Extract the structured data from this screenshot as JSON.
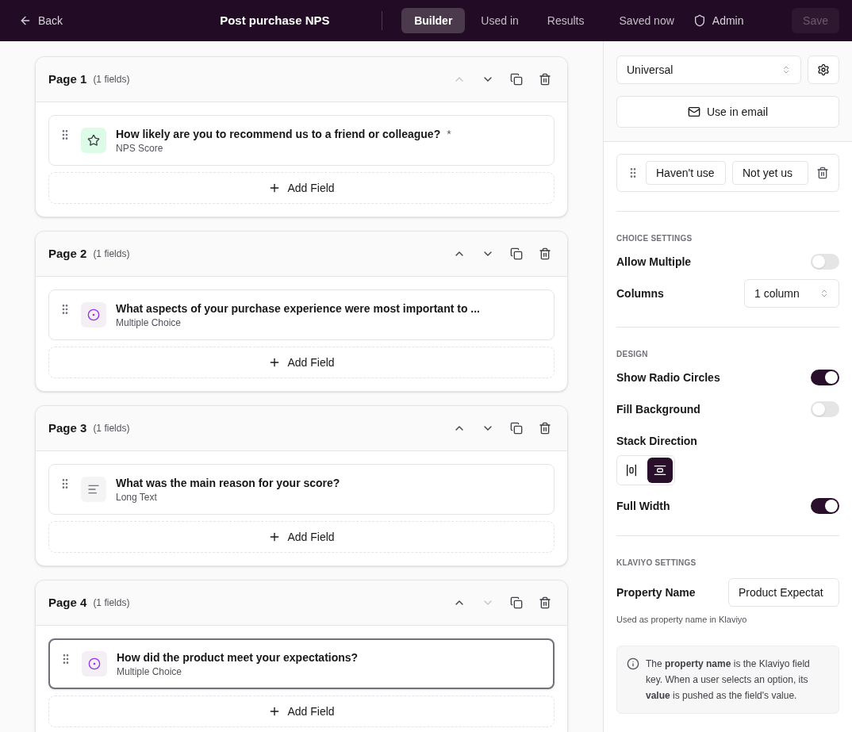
{
  "topbar": {
    "back": "Back",
    "title": "Post purchase NPS",
    "tabs": [
      {
        "label": "Builder",
        "selected": true
      },
      {
        "label": "Used in",
        "selected": false
      },
      {
        "label": "Results",
        "selected": false
      }
    ],
    "status": "Saved now",
    "admin": "Admin",
    "save": {
      "label": "Save",
      "disabled": true
    }
  },
  "pages": [
    {
      "title": "Page 1",
      "count": "(1 fields)",
      "up_disabled": true,
      "down_disabled": false,
      "fields": [
        {
          "kind": "nps",
          "question": "How likely are you to recommend us to a friend or colleague?",
          "required_mark": "*",
          "type": "NPS Score",
          "selected": false
        }
      ],
      "add": "Add Field"
    },
    {
      "title": "Page 2",
      "count": "(1 fields)",
      "up_disabled": false,
      "down_disabled": false,
      "fields": [
        {
          "kind": "choice",
          "question": "What aspects of your purchase experience were most important to ...",
          "type": "Multiple Choice",
          "selected": false
        }
      ],
      "add": "Add Field"
    },
    {
      "title": "Page 3",
      "count": "(1 fields)",
      "up_disabled": false,
      "down_disabled": false,
      "fields": [
        {
          "kind": "text",
          "question": "What was the main reason for your score?",
          "type": "Long Text",
          "selected": false
        }
      ],
      "add": "Add Field"
    },
    {
      "title": "Page 4",
      "count": "(1 fields)",
      "up_disabled": false,
      "down_disabled": true,
      "fields": [
        {
          "kind": "choice",
          "question": "How did the product meet your expectations?",
          "type": "Multiple Choice",
          "selected": true
        }
      ],
      "add": "Add Field"
    }
  ],
  "panel": {
    "variant": "Universal",
    "use_in_email": "Use in email",
    "option": {
      "label": "Haven't use",
      "value": "Not yet us"
    },
    "choice_settings": {
      "heading": "CHOICE SETTINGS",
      "allow_multiple": {
        "label": "Allow Multiple",
        "on": false
      },
      "columns": {
        "label": "Columns",
        "value": "1 column"
      }
    },
    "design": {
      "heading": "DESIGN",
      "show_radio": {
        "label": "Show Radio Circles",
        "on": true
      },
      "fill_background": {
        "label": "Fill Background",
        "on": false
      },
      "stack_direction": {
        "label": "Stack Direction",
        "options": [
          {
            "kind": "horizontal",
            "selected": false
          },
          {
            "kind": "vertical",
            "selected": true
          }
        ]
      },
      "full_width": {
        "label": "Full Width",
        "on": true
      }
    },
    "klaviyo": {
      "heading": "KLAVIYO SETTINGS",
      "property_label": "Property Name",
      "property_value": "Product Expectat",
      "hint": "Used as property name in Klaviyo",
      "info": "The **property name** is the Klaviyo field key. When a user selects an option, its **value** is pushed as the field's value."
    }
  }
}
